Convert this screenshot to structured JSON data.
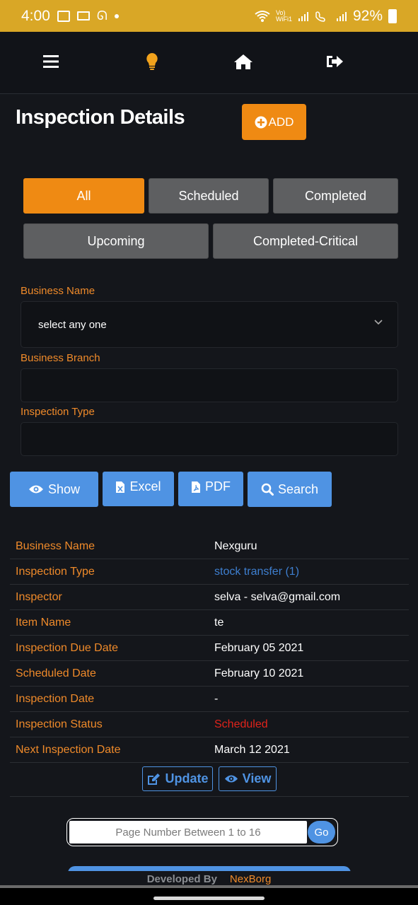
{
  "status_bar": {
    "time": "4:00",
    "battery": "92%"
  },
  "page": {
    "title": "Inspection Details",
    "add_label": "ADD"
  },
  "tabs": [
    {
      "label": "All",
      "active": true
    },
    {
      "label": "Scheduled",
      "active": false
    },
    {
      "label": "Completed",
      "active": false
    },
    {
      "label": "Upcoming",
      "active": false
    },
    {
      "label": "Completed-Critical",
      "active": false
    }
  ],
  "filters": {
    "business_name_label": "Business Name",
    "business_name_value": "select any one",
    "business_branch_label": "Business Branch",
    "inspection_type_label": "Inspection Type"
  },
  "actions": {
    "show": "Show",
    "excel": "Excel",
    "pdf": "PDF",
    "search": "Search"
  },
  "details": [
    {
      "key": "Business Name",
      "value": "Nexguru",
      "style": "normal"
    },
    {
      "key": "Inspection Type",
      "value": "stock transfer (1)",
      "style": "link"
    },
    {
      "key": "Inspector",
      "value": "selva - selva@gmail.com",
      "style": "normal"
    },
    {
      "key": "Item Name",
      "value": "te",
      "style": "normal"
    },
    {
      "key": "Inspection Due Date",
      "value": "February 05 2021",
      "style": "normal"
    },
    {
      "key": "Scheduled Date",
      "value": "February 10 2021",
      "style": "normal"
    },
    {
      "key": "Inspection Date",
      "value": "-",
      "style": "normal"
    },
    {
      "key": "Inspection Status",
      "value": "Scheduled",
      "style": "red"
    },
    {
      "key": "Next Inspection Date",
      "value": "March 12 2021",
      "style": "normal"
    }
  ],
  "row_actions": {
    "update": "Update",
    "view": "View"
  },
  "pager": {
    "placeholder": "Page Number Between 1 to 16",
    "go": "Go"
  },
  "footer": {
    "developed_by": "Developed By",
    "company": "NexBorg"
  },
  "colors": {
    "accent": "#ef8a13",
    "primary": "#4f93e3",
    "status_bar": "#d9a726",
    "danger": "#e0231b"
  }
}
